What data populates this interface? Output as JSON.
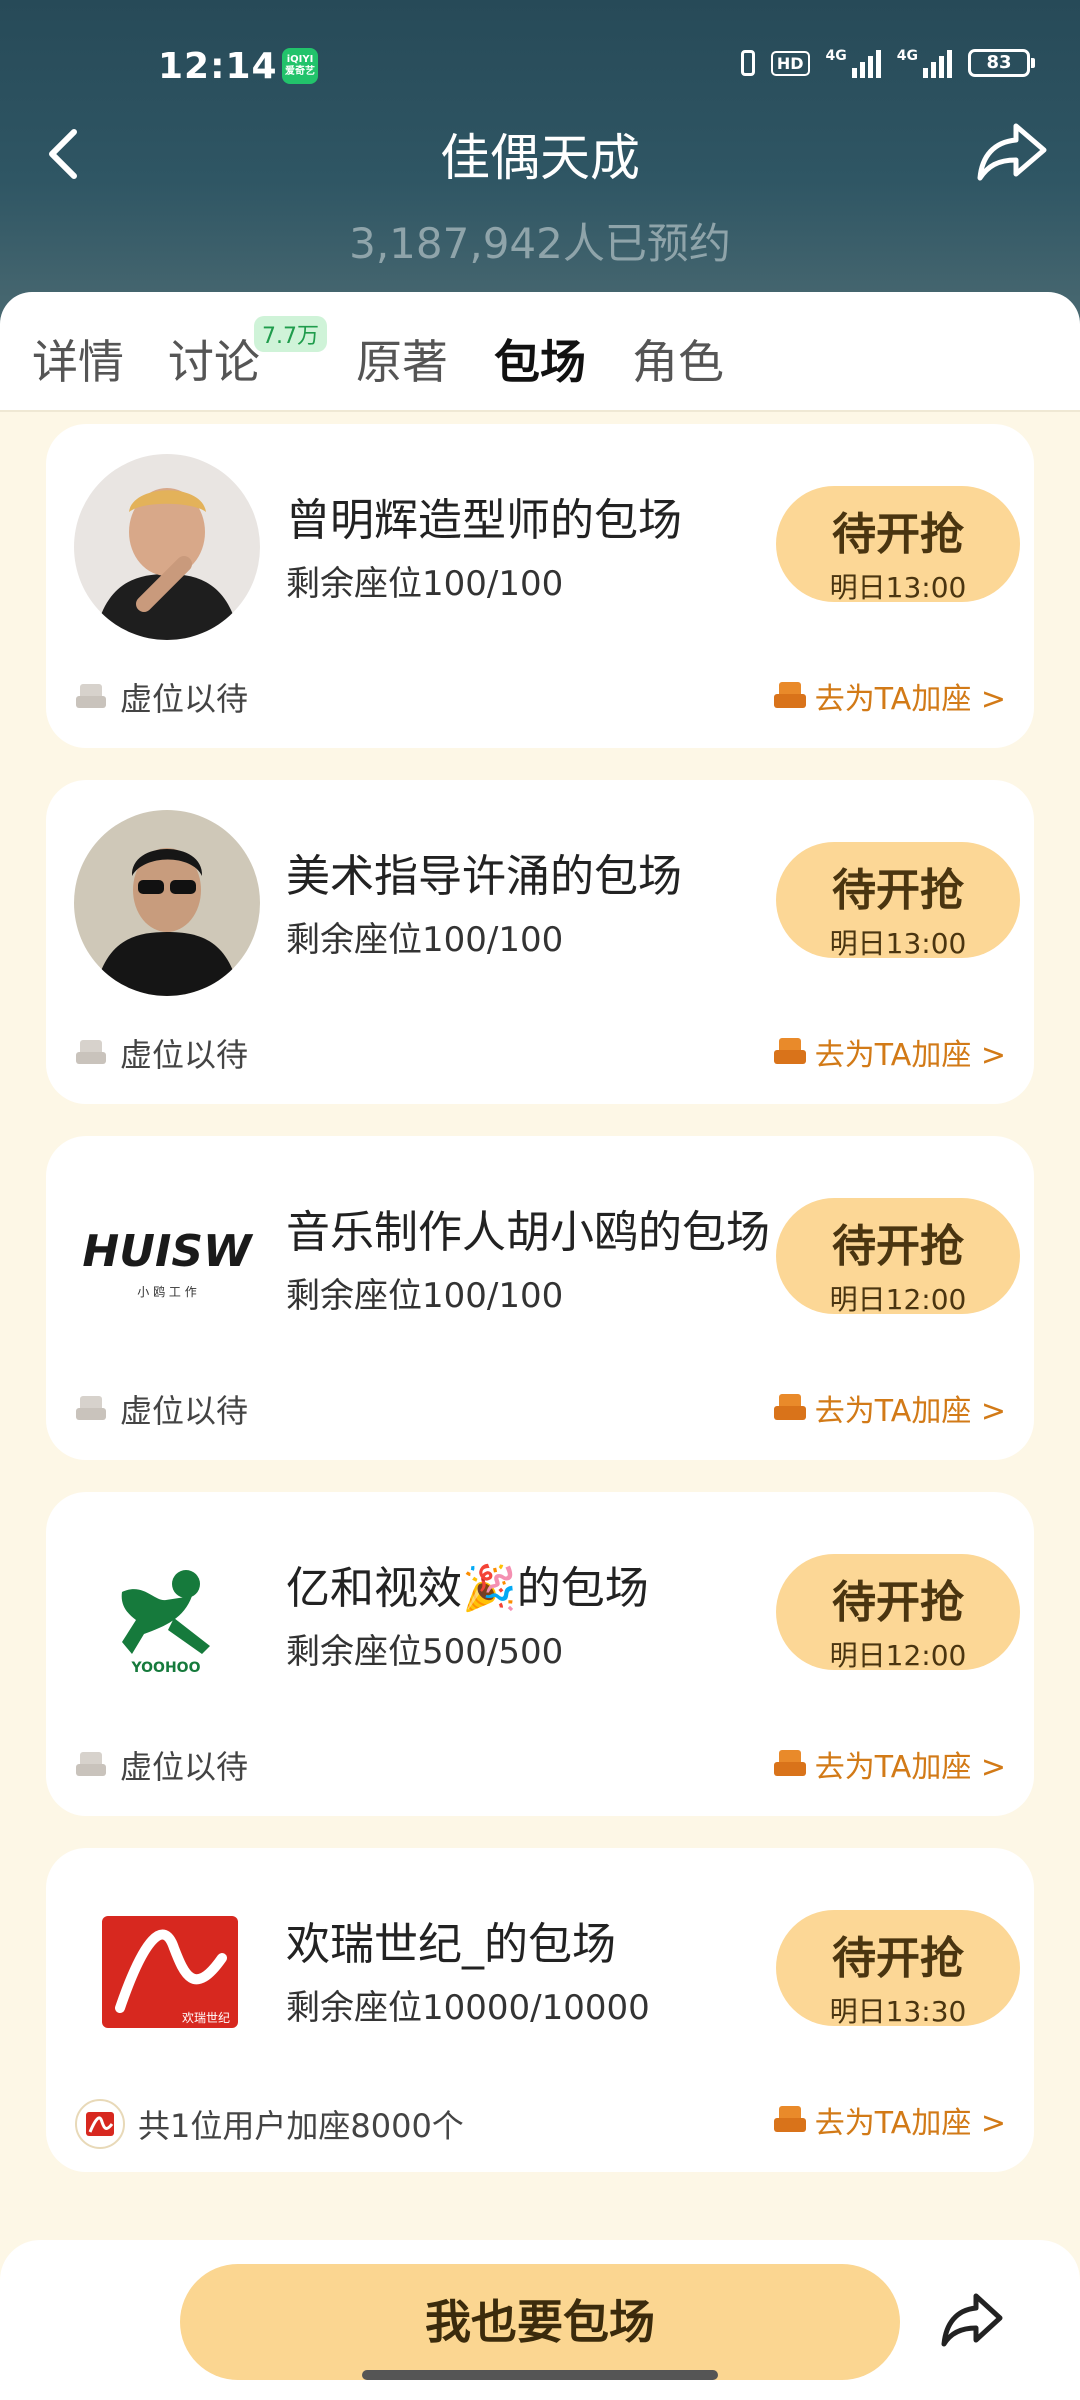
{
  "status_bar": {
    "time": "12:14",
    "app_badge": "iQIYI\n爱奇艺",
    "hd": "HD",
    "net1": "4G",
    "net2": "4G",
    "battery": "83"
  },
  "header": {
    "title": "佳偶天成",
    "subtitle": "3,187,942人已预约"
  },
  "tabs": [
    {
      "label": "详情"
    },
    {
      "label": "讨论",
      "badge": "7.7万"
    },
    {
      "label": "原著"
    },
    {
      "label": "包场"
    },
    {
      "label": "角色"
    }
  ],
  "cards": [
    {
      "name": "曾明辉造型师的包场",
      "seats": "剩余座位100/100",
      "button": "待开抢",
      "time": "明日13:00",
      "status": "虚位以待",
      "link": "去为TA加座 >"
    },
    {
      "name": "美术指导许涌的包场",
      "seats": "剩余座位100/100",
      "button": "待开抢",
      "time": "明日13:00",
      "status": "虚位以待",
      "link": "去为TA加座 >"
    },
    {
      "name": "音乐制作人胡小鸥的包场",
      "seats": "剩余座位100/100",
      "button": "待开抢",
      "time": "明日12:00",
      "status": "虚位以待",
      "link": "去为TA加座 >",
      "logo_text": "HUISW",
      "logo_sub": "小 鸥 工 作"
    },
    {
      "name": "亿和视效🎉的包场",
      "seats": "剩余座位500/500",
      "button": "待开抢",
      "time": "明日12:00",
      "status": "虚位以待",
      "link": "去为TA加座 >",
      "logo_text": "YOOHOO"
    },
    {
      "name": "欢瑞世纪_的包场",
      "seats": "剩余座位10000/10000",
      "button": "待开抢",
      "time": "明日13:30",
      "status": "共1位用户加座8000个",
      "link": "去为TA加座 >",
      "logo_text": "欢瑞世纪"
    }
  ],
  "bottom": {
    "cta": "我也要包场"
  },
  "colors": {
    "accent": "#fcd796",
    "link": "#d27a17",
    "header_bg": "#2a4d5b",
    "page_bg": "#fdf7e6"
  }
}
